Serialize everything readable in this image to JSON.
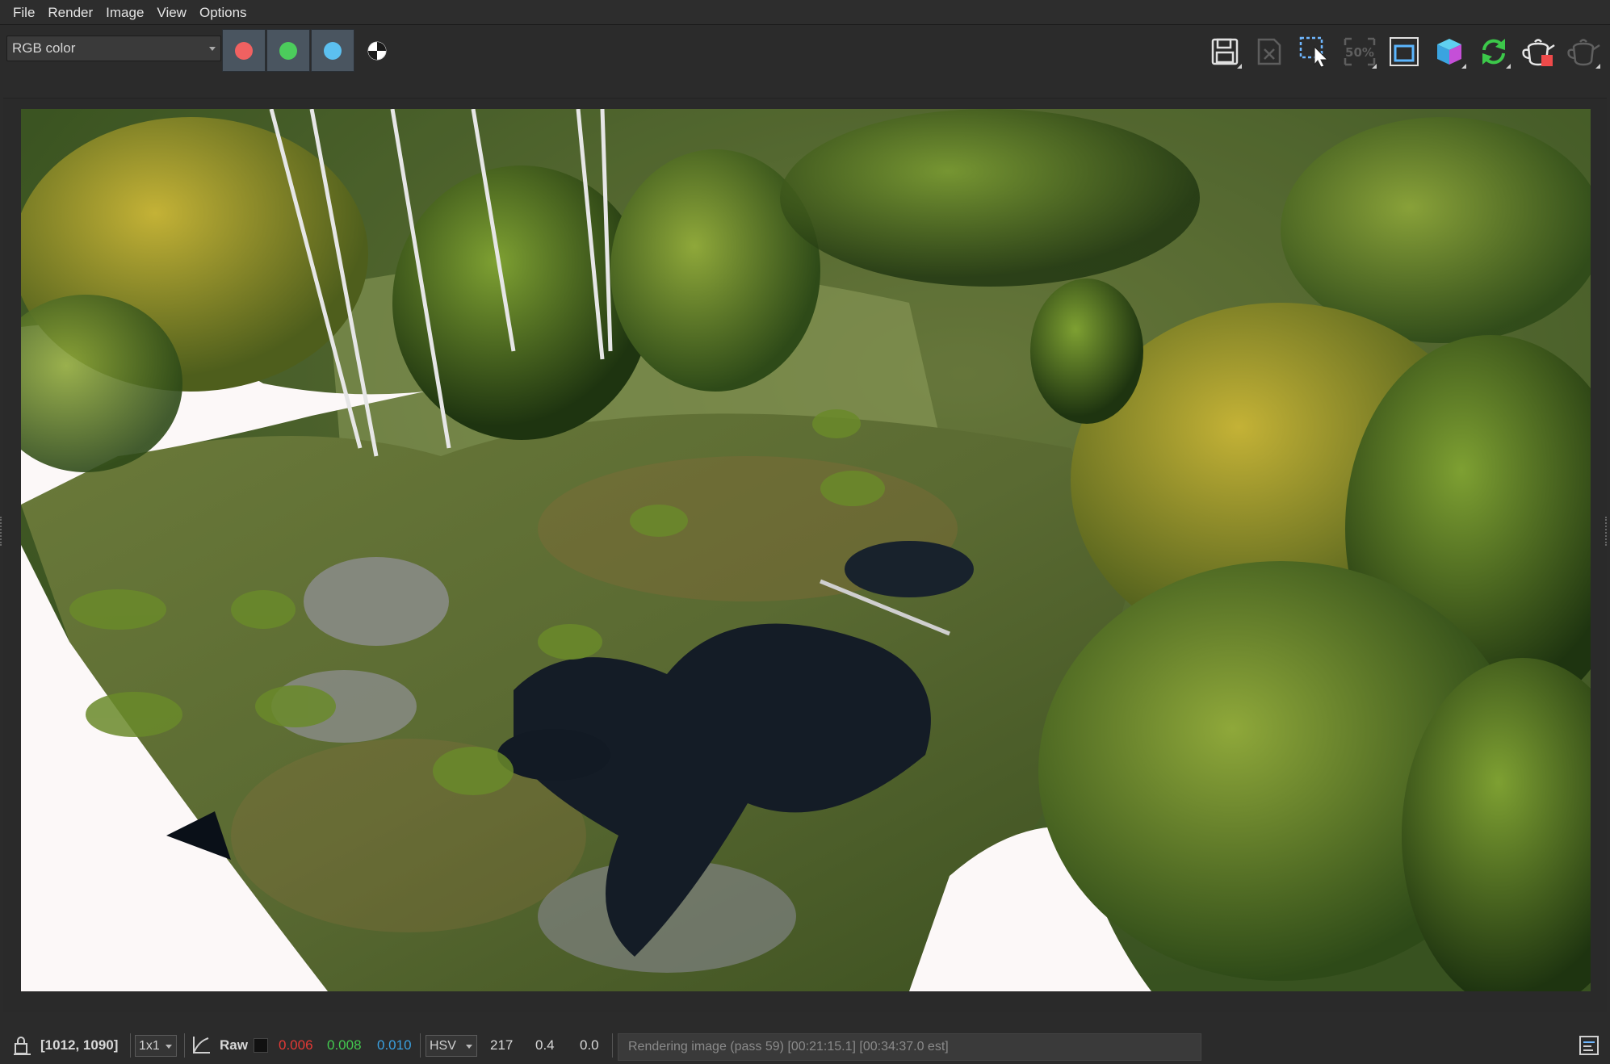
{
  "menu": [
    "File",
    "Render",
    "Image",
    "View",
    "Options"
  ],
  "toolbar": {
    "channel_select": "RGB color",
    "channels": [
      {
        "name": "red-channel",
        "color": "#f05a5a"
      },
      {
        "name": "green-channel",
        "color": "#4ccf5a"
      },
      {
        "name": "blue-channel",
        "color": "#4fb7ee"
      }
    ],
    "zoom_badge": "50%",
    "tools": [
      "save-icon",
      "clear-icon",
      "region-select-icon",
      "zoom-50-icon",
      "frame-icon",
      "cube-icon",
      "refresh-icon",
      "teapot-render-icon",
      "teapot-icon"
    ]
  },
  "colors": {
    "background": "#2b2b2b",
    "red": "#e53935",
    "green": "#43c94f",
    "blue": "#3aa0e0"
  },
  "status": {
    "coords": "[1012, 1090]",
    "scale": "1x1",
    "mode": "Raw",
    "r": "0.006",
    "g": "0.008",
    "b": "0.010",
    "color_space": "HSV",
    "h": "217",
    "s": "0.4",
    "v": "0.0",
    "progress_text": "Rendering image (pass 59) [00:21:15.1] [00:34:37.0 est]"
  }
}
